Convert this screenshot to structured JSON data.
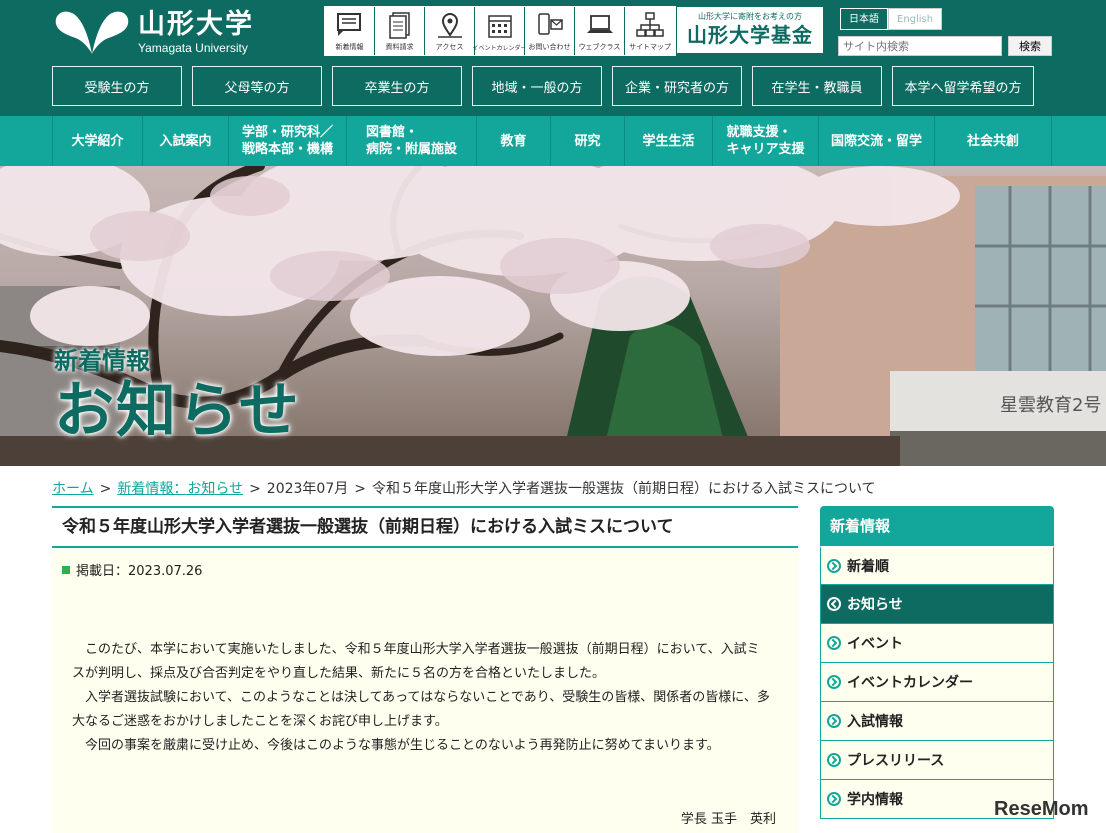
{
  "header": {
    "logo_jp": "山形大学",
    "logo_en": "Yamagata University",
    "util_icons": [
      {
        "label": "新着情報",
        "icon": "news-icon"
      },
      {
        "label": "資料請求",
        "icon": "document-icon"
      },
      {
        "label": "アクセス",
        "icon": "map-pin-icon"
      },
      {
        "label": "イベントカレンダー",
        "icon": "calendar-icon"
      },
      {
        "label": "お問い合わせ",
        "icon": "phone-mail-icon"
      },
      {
        "label": "ウェブクラス",
        "icon": "laptop-icon"
      },
      {
        "label": "サイトマップ",
        "icon": "sitemap-icon"
      }
    ],
    "fund_small": "山形大学に寄附をお考えの方",
    "fund_big": "山形大学基金",
    "lang_jp": "日本語",
    "lang_en": "English",
    "search_placeholder": "サイト内検索",
    "search_button": "検索",
    "audience": [
      "受験生の方",
      "父母等の方",
      "卒業生の方",
      "地域・一般の方",
      "企業・研究者の方",
      "在学生・教職員",
      "本学へ留学希望の方"
    ]
  },
  "gnav": [
    {
      "line1": "大学紹介",
      "line2": ""
    },
    {
      "line1": "入試案内",
      "line2": ""
    },
    {
      "line1": "学部・研究科／",
      "line2": "戦略本部・機構"
    },
    {
      "line1": "図書館・",
      "line2": "病院・附属施設"
    },
    {
      "line1": "教育",
      "line2": ""
    },
    {
      "line1": "研究",
      "line2": ""
    },
    {
      "line1": "学生生活",
      "line2": ""
    },
    {
      "line1": "就職支援・",
      "line2": "キャリア支援"
    },
    {
      "line1": "国際交流・留学",
      "line2": ""
    },
    {
      "line1": "社会共創",
      "line2": ""
    }
  ],
  "hero": {
    "title_small": "新着情報",
    "title_big": "お知らせ"
  },
  "breadcrumb": {
    "home": "ホーム",
    "news": "新着情報：お知らせ",
    "month": "2023年07月",
    "current": "令和５年度山形大学入学者選抜一般選抜（前期日程）における入試ミスについて",
    "sep": ">"
  },
  "article": {
    "title": "令和５年度山形大学入学者選抜一般選抜（前期日程）における入試ミスについて",
    "date": "掲載日：2023.07.26",
    "paragraphs": [
      "このたび、本学において実施いたしました、令和５年度山形大学入学者選抜一般選抜（前期日程）において、入試ミスが判明し、採点及び合否判定をやり直した結果、新たに５名の方を合格といたしました。",
      "入学者選抜試験において、このようなことは決してあってはならないことであり、受験生の皆様、関係者の皆様に、多大なるご迷惑をおかけしましたことを深くお詫び申し上げます。",
      "今回の事案を厳粛に受け止め、今後はこのような事態が生じることのないよう再発防止に努めてまいります。"
    ],
    "signature": "学長 玉手　英利"
  },
  "sidebar": {
    "heading": "新着情報",
    "items": [
      "新着順",
      "お知らせ",
      "イベント",
      "イベントカレンダー",
      "入試情報",
      "プレスリリース",
      "学内情報"
    ],
    "active_index": 1
  },
  "watermark": "ReseMom",
  "colors": {
    "brand_dark": "#0d6b61",
    "brand_teal": "#13a69b",
    "article_bg": "#fffff0"
  }
}
